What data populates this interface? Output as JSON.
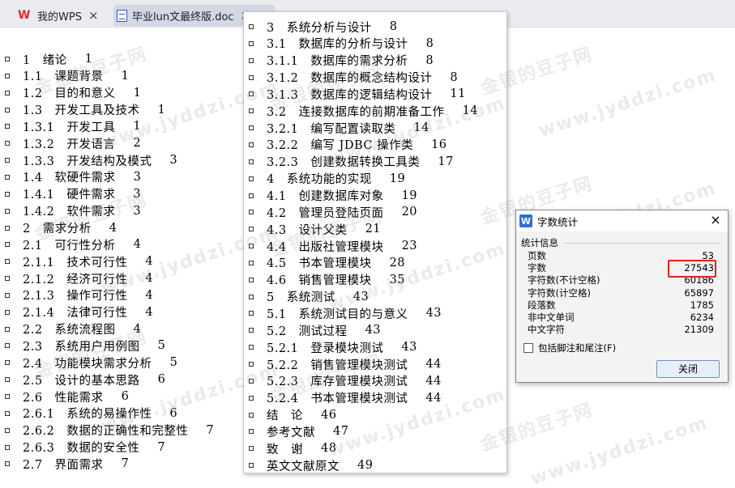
{
  "tabs": [
    {
      "label": "我的WPS",
      "close": "×"
    },
    {
      "label": "毕业lun文最终版.doc",
      "close": "×"
    }
  ],
  "watermark": [
    "金银的豆子网",
    "www.jyddzi.com"
  ],
  "left_toc": [
    {
      "text": "1　绪论",
      "page": "1"
    },
    {
      "text": "1.1　课题背景",
      "page": "1"
    },
    {
      "text": "1.2　目的和意义",
      "page": "1"
    },
    {
      "text": "1.3　开发工具及技术",
      "page": "1"
    },
    {
      "text": "1.3.1　开发工具",
      "page": "1"
    },
    {
      "text": "1.3.2　开发语言",
      "page": "2"
    },
    {
      "text": "1.3.3　开发结构及模式",
      "page": "3"
    },
    {
      "text": "1.4　软硬件需求",
      "page": "3"
    },
    {
      "text": "1.4.1　硬件需求",
      "page": "3"
    },
    {
      "text": "1.4.2　软件需求",
      "page": "3"
    },
    {
      "text": "2　需求分析",
      "page": "4"
    },
    {
      "text": "2.1　可行性分析",
      "page": "4"
    },
    {
      "text": "2.1.1　技术可行性",
      "page": "4"
    },
    {
      "text": "2.1.2　经济可行性",
      "page": "4"
    },
    {
      "text": "2.1.3　操作可行性",
      "page": "4"
    },
    {
      "text": "2.1.4　法律可行性",
      "page": "4"
    },
    {
      "text": "2.2　系统流程图",
      "page": "4"
    },
    {
      "text": "2.3　系统用户用例图",
      "page": "5"
    },
    {
      "text": "2.4　功能模块需求分析",
      "page": "5"
    },
    {
      "text": "2.5　设计的基本思路",
      "page": "6"
    },
    {
      "text": "2.6　性能需求",
      "page": "6"
    },
    {
      "text": "2.6.1　系统的易操作性",
      "page": "6"
    },
    {
      "text": "2.6.2　数据的正确性和完整性",
      "page": "7"
    },
    {
      "text": "2.6.3　数据的安全性",
      "page": "7"
    },
    {
      "text": "2.7　界面需求",
      "page": "7"
    }
  ],
  "popup_toc": [
    {
      "text": "3　系统分析与设计",
      "page": "8"
    },
    {
      "text": "3.1　数据库的分析与设计",
      "page": "8"
    },
    {
      "text": "3.1.1　数据库的需求分析",
      "page": "8"
    },
    {
      "text": "3.1.2　数据库的概念结构设计",
      "page": "8"
    },
    {
      "text": "3.1.3　数据库的逻辑结构设计",
      "page": "11"
    },
    {
      "text": "3.2　连接数据库的前期准备工作",
      "page": "14"
    },
    {
      "text": "3.2.1　编写配置读取类",
      "page": "14"
    },
    {
      "text": "3.2.2　编写 JDBC 操作类",
      "page": "16"
    },
    {
      "text": "3.2.3　创建数据转换工具类",
      "page": "17"
    },
    {
      "text": "4　系统功能的实现",
      "page": "19"
    },
    {
      "text": "4.1　创建数据库对象",
      "page": "19"
    },
    {
      "text": "4.2　管理员登陆页面",
      "page": "20"
    },
    {
      "text": "4.3　设计父类",
      "page": "21"
    },
    {
      "text": "4.4　出版社管理模块",
      "page": "23"
    },
    {
      "text": "4.5　书本管理模块",
      "page": "28"
    },
    {
      "text": "4.6　销售管理模块",
      "page": "35"
    },
    {
      "text": "5　系统测试",
      "page": "43"
    },
    {
      "text": "5.1　系统测试目的与意义",
      "page": "43"
    },
    {
      "text": "5.2　测试过程",
      "page": "43"
    },
    {
      "text": "5.2.1　登录模块测试",
      "page": "43"
    },
    {
      "text": "5.2.2　销售管理模块测试",
      "page": "44"
    },
    {
      "text": "5.2.3　库存管理模块测试",
      "page": "44"
    },
    {
      "text": "5.2.4　书本管理模块测试",
      "page": "44"
    },
    {
      "text": "结　论",
      "page": "46"
    },
    {
      "text": "参考文献",
      "page": "47"
    },
    {
      "text": "致　谢",
      "page": "48"
    },
    {
      "text": "英文文献原文",
      "page": "49"
    }
  ],
  "dialog": {
    "title": "字数统计",
    "close": "×",
    "group_title": "统计信息",
    "stats": [
      {
        "label": "页数",
        "value": "53"
      },
      {
        "label": "字数",
        "value": "27543"
      },
      {
        "label": "字符数(不计空格)",
        "value": "60186"
      },
      {
        "label": "字符数(计空格)",
        "value": "65897"
      },
      {
        "label": "段落数",
        "value": "1785"
      },
      {
        "label": "非中文单词",
        "value": "6234"
      },
      {
        "label": "中文字符",
        "value": "21309"
      }
    ],
    "checkbox_label": "包括脚注和尾注(F)",
    "button_label": "关闭",
    "highlight_color": "#e4201f"
  }
}
